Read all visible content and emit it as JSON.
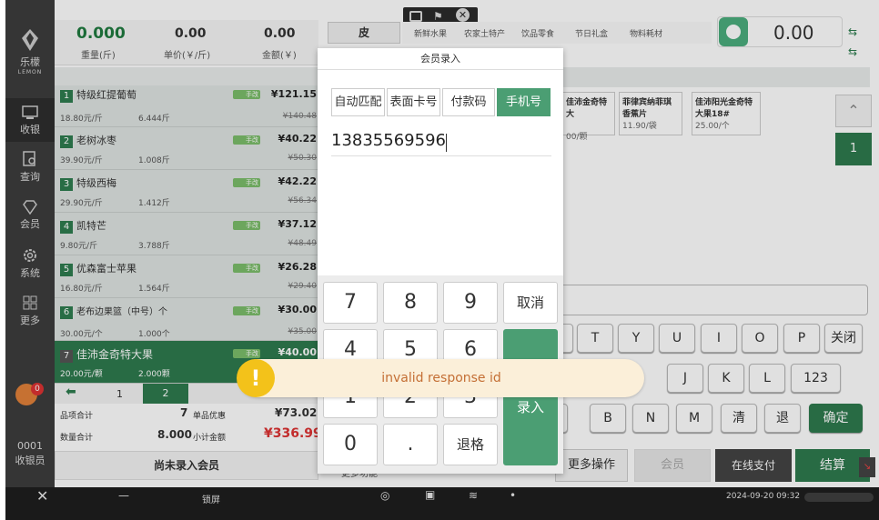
{
  "brand": {
    "name": "乐檬",
    "sub": "LEMON"
  },
  "sidebar": {
    "items": [
      {
        "label": "收银"
      },
      {
        "label": "查询"
      },
      {
        "label": "会员"
      },
      {
        "label": "系统"
      },
      {
        "label": "更多"
      }
    ],
    "badge": "0",
    "cashier_id": "0001",
    "cashier_role": "收银员"
  },
  "summary": {
    "weight_value": "0.000",
    "weight_label": "重量(斤)",
    "unit_value": "0.00",
    "unit_label": "单价(￥/斤)",
    "amount_value": "0.00",
    "amount_label": "金额(￥)",
    "tare_label": "皮"
  },
  "topbar": {
    "categories": [
      "新鲜水果",
      "农家土特产",
      "饮品零食",
      "节日礼盒",
      "物料耗材"
    ],
    "display_value": "0.00"
  },
  "order_items": [
    {
      "index": "1",
      "name": "特级红提葡萄",
      "unit_price": "18.80元/斤",
      "qty": "6.444斤",
      "price": "¥121.15",
      "orig": "¥140.48",
      "tag": "手改"
    },
    {
      "index": "2",
      "name": "老树冰枣",
      "unit_price": "39.90元/斤",
      "qty": "1.008斤",
      "price": "¥40.22",
      "orig": "¥50.30",
      "tag": "手改"
    },
    {
      "index": "3",
      "name": "特级西梅",
      "unit_price": "29.90元/斤",
      "qty": "1.412斤",
      "price": "¥42.22",
      "orig": "¥56.34",
      "tag": "手改"
    },
    {
      "index": "4",
      "name": "凯特芒",
      "unit_price": "9.80元/斤",
      "qty": "3.788斤",
      "price": "¥37.12",
      "orig": "¥48.49",
      "tag": "手改"
    },
    {
      "index": "5",
      "name": "优森富士苹果",
      "unit_price": "16.80元/斤",
      "qty": "1.564斤",
      "price": "¥26.28",
      "orig": "¥29.40",
      "tag": "手改"
    },
    {
      "index": "6",
      "name": "老布边果篮（中号）个",
      "unit_price": "30.00元/个",
      "qty": "1.000个",
      "price": "¥30.00",
      "orig": "¥35.00",
      "tag": "手改"
    },
    {
      "index": "7",
      "name": "佳沛金奇特大果",
      "unit_price": "20.00元/颗",
      "qty": "2.000颗",
      "price": "¥40.00",
      "orig": "",
      "tag": "手改"
    }
  ],
  "pager": {
    "pages": [
      "1",
      "2"
    ]
  },
  "totals": {
    "items_label": "品项合计",
    "items_value": "7",
    "discount_label": "单品优惠",
    "discount_value": "¥73.02",
    "qty_label": "数量合计",
    "qty_value": "8.000",
    "subtotal_label": "小计金额",
    "subtotal_value": "¥336.99"
  },
  "no_member": "尚未录入会员",
  "more_func": "更多功能",
  "products": [
    {
      "name": "佳沛金奇特大",
      "price": "00/颗"
    },
    {
      "name": "菲律宾纳菲琪香蕉片",
      "price": "11.90/袋"
    },
    {
      "name": "佳沛阳光金奇特大果18#",
      "price": "25.00/个"
    }
  ],
  "page_indicator": "1",
  "keyboard": {
    "row1": [
      "T",
      "Y",
      "U",
      "I",
      "O",
      "P",
      "关闭"
    ],
    "row2": [
      "J",
      "K",
      "L",
      "123"
    ],
    "row3": [
      "B",
      "N",
      "M",
      "清",
      "退",
      "确定"
    ]
  },
  "actions": {
    "more": "更多操作",
    "member": "会员",
    "online_pay": "在线支付",
    "checkout": "结算"
  },
  "modal": {
    "title": "会员录入",
    "tabs": [
      "自动匹配",
      "表面卡号",
      "付款码",
      "手机号"
    ],
    "phone": "13835569596",
    "keys": [
      "7",
      "8",
      "9",
      "取消",
      "4",
      "5",
      "6",
      "1",
      "2",
      "3",
      "0",
      ".",
      "退格"
    ],
    "enter": "录入"
  },
  "toast": {
    "message": "invalid response id"
  },
  "taskbar": {
    "lock": "锁屏",
    "datetime": "2024-09-20 09:32"
  }
}
